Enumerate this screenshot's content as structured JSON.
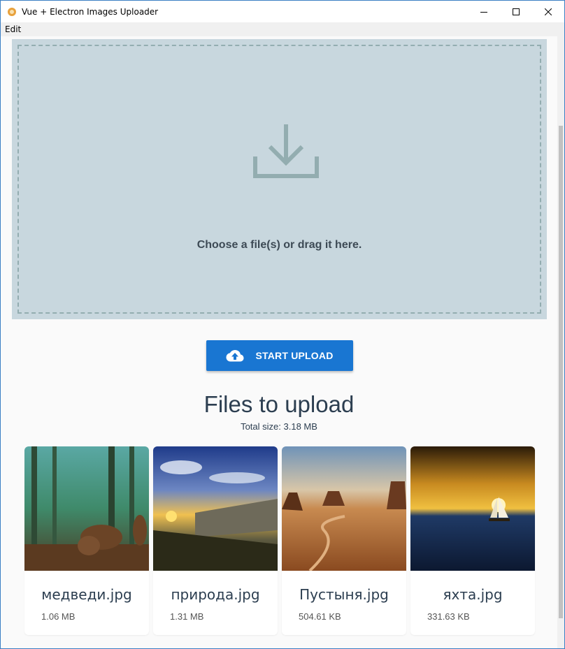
{
  "window": {
    "title": "Vue + Electron Images Uploader"
  },
  "menu": {
    "items": [
      "Edit"
    ]
  },
  "dropzone": {
    "text": "Choose a file(s) or drag it here.",
    "icon": "download-icon"
  },
  "upload_button": {
    "label": "START UPLOAD",
    "icon": "cloud-upload-icon",
    "color": "#1976d2"
  },
  "files_section": {
    "title": "Files to upload",
    "total_size": "Total size: 3.18 MB"
  },
  "files": [
    {
      "name": "медведи.jpg",
      "size": "1.06 MB"
    },
    {
      "name": "природа.jpg",
      "size": "1.31 MB"
    },
    {
      "name": "Пустыня.jpg",
      "size": "504.61 KB"
    },
    {
      "name": "яхта.jpg",
      "size": "331.63 KB"
    }
  ]
}
